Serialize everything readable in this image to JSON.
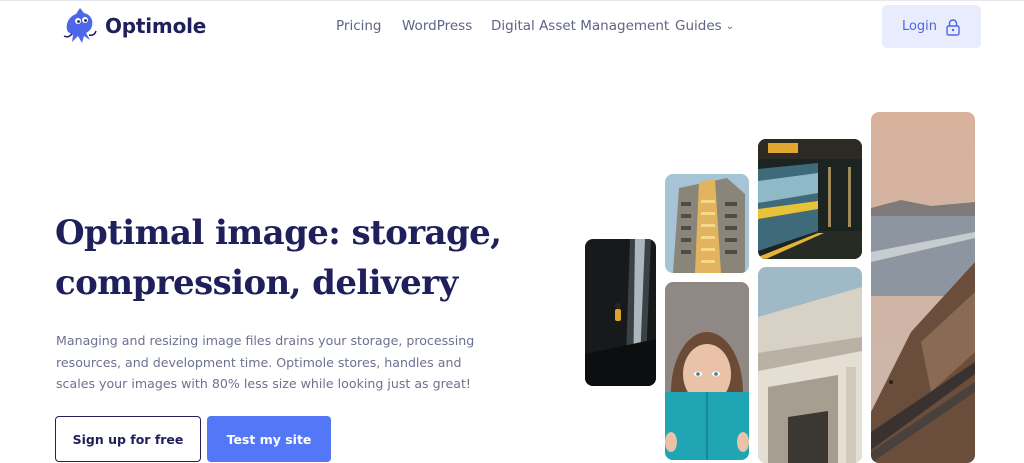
{
  "brand": {
    "name": "Optimole",
    "logo_icon": "octopus-mascot-icon"
  },
  "nav": {
    "items": [
      {
        "label": "Pricing"
      },
      {
        "label": "WordPress"
      },
      {
        "label": "Digital Asset Management"
      },
      {
        "label": "Guides",
        "icon": "chevron-down-icon"
      }
    ]
  },
  "login": {
    "label": "Login",
    "icon": "lock-icon"
  },
  "hero": {
    "title_line1": "Optimal image: storage,",
    "title_line2": "compression, delivery",
    "description_line1": "Managing and resizing image files drains your storage, processing",
    "description_line2": "resources, and development time. Optimole stores, handles and",
    "description_line3": "scales your images with 80% less size while looking just as great!"
  },
  "cta": {
    "signup_label": "Sign up for free",
    "test_label": "Test my site"
  },
  "gallery": {
    "images": [
      {
        "subject": "waterfall hiker"
      },
      {
        "subject": "building facade"
      },
      {
        "subject": "reader with book"
      },
      {
        "subject": "subway train"
      },
      {
        "subject": "concrete overpass"
      },
      {
        "subject": "coastline road"
      }
    ]
  },
  "colors": {
    "brand_navy": "#1f1f5c",
    "accent_blue": "#5377f6",
    "login_bg": "#e9ecfc",
    "muted_text": "#6d7190"
  }
}
